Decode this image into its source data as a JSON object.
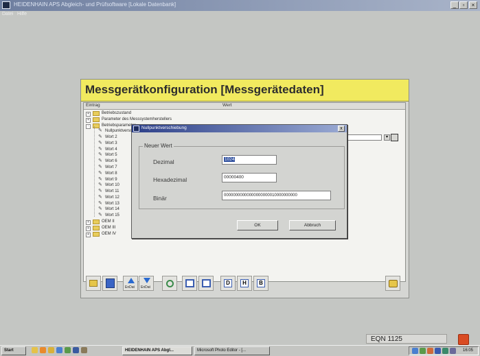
{
  "app": {
    "title": "HEIDENHAIN APS Abgleich- und Prüfsoftware [Lokale Datenbank]",
    "menu": [
      "Datei",
      "Hilfe"
    ]
  },
  "panel": {
    "title": "Messgerätkonfiguration [Messgerätedaten]",
    "col_entry": "Eintrag",
    "col_value": "Wert",
    "tree": [
      {
        "label": "Betriebszustand",
        "type": "folder",
        "expander": "+"
      },
      {
        "label": "Parameter des Messsystemherstellers",
        "type": "folder",
        "expander": "+"
      },
      {
        "label": "Betriebsparameter",
        "type": "folder",
        "expander": "-"
      },
      {
        "label": "Nullpunktverschiebung",
        "type": "leaf"
      },
      {
        "label": "Wort 2",
        "type": "leaf"
      },
      {
        "label": "Wort 3",
        "type": "leaf"
      },
      {
        "label": "Wort 4",
        "type": "leaf"
      },
      {
        "label": "Wort 5",
        "type": "leaf"
      },
      {
        "label": "Wort 6",
        "type": "leaf"
      },
      {
        "label": "Wort 7",
        "type": "leaf"
      },
      {
        "label": "Wort 8",
        "type": "leaf"
      },
      {
        "label": "Wort 9",
        "type": "leaf"
      },
      {
        "label": "Wort 10",
        "type": "leaf"
      },
      {
        "label": "Wort 11",
        "type": "leaf"
      },
      {
        "label": "Wort 12",
        "type": "leaf"
      },
      {
        "label": "Wort 13",
        "type": "leaf"
      },
      {
        "label": "Wort 14",
        "type": "leaf"
      },
      {
        "label": "Wort 15",
        "type": "leaf"
      },
      {
        "label": "OEM II",
        "type": "folder",
        "expander": "+"
      },
      {
        "label": "OEM III",
        "type": "folder",
        "expander": "+"
      },
      {
        "label": "OEM IV",
        "type": "folder",
        "expander": "+"
      }
    ],
    "selected_value": "1024",
    "toolbar": {
      "upload_label": "EnDat",
      "download_label": "EnDat",
      "dec_label": "D",
      "hex_label": "H",
      "bin_label": "B"
    }
  },
  "dialog": {
    "title": "Nullpunktverschiebung",
    "close": "x",
    "group_label": "Neuer Wert",
    "dezimal_label": "Dezimal",
    "dezimal_value": "1024",
    "hex_label": "Hexadezimal",
    "hex_value": "00000400",
    "bin_label": "Binär",
    "bin_value": "00000000000000000000010000000000",
    "ok_label": "OK",
    "cancel_label": "Abbruch"
  },
  "status": {
    "device": "EQN 1125"
  },
  "taskbar": {
    "start": "Start",
    "tasks": [
      "HEIDENHAIN APS Abgl...",
      "Microsoft Photo Editor - [..."
    ],
    "clock": "16:05"
  },
  "colors": {
    "header_yellow": "#f1ea5f",
    "dialog_title_blue": "#2c3f88",
    "selection_blue": "#2e4f9e"
  }
}
